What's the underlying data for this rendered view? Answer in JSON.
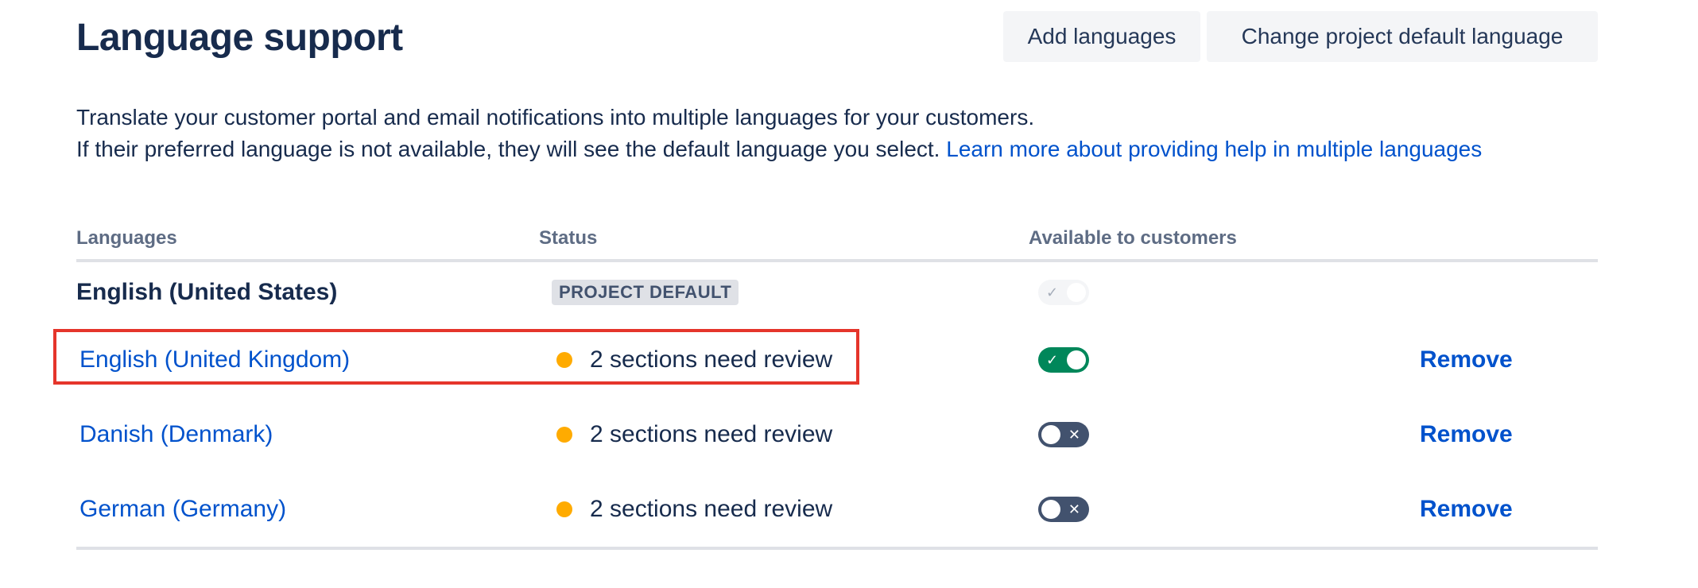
{
  "header": {
    "title": "Language support",
    "add_button": "Add languages",
    "default_button": "Change project default language"
  },
  "description": {
    "line1": "Translate your customer portal and email notifications into multiple languages for your customers.",
    "line2": "If their preferred language is not available, they will see the default language you select. ",
    "link": "Learn more about providing help in multiple languages"
  },
  "table": {
    "columns": [
      "Languages",
      "Status",
      "Available to customers"
    ],
    "default_row": {
      "language": "English (United States)",
      "badge": "PROJECT DEFAULT",
      "toggle_glyph": "✓"
    },
    "rows": [
      {
        "language": "English (United Kingdom)",
        "status": "2 sections need review",
        "available": true,
        "toggle_glyph": "✓",
        "remove": "Remove"
      },
      {
        "language": "Danish (Denmark)",
        "status": "2 sections need review",
        "available": false,
        "toggle_glyph": "✕",
        "remove": "Remove"
      },
      {
        "language": "German (Germany)",
        "status": "2 sections need review",
        "available": false,
        "toggle_glyph": "✕",
        "remove": "Remove"
      }
    ]
  },
  "colors": {
    "link": "#0052CC",
    "status_dot": "#FFAB00",
    "toggle_on": "#00875A",
    "toggle_off": "#42526E",
    "highlight": "#E5352B"
  }
}
